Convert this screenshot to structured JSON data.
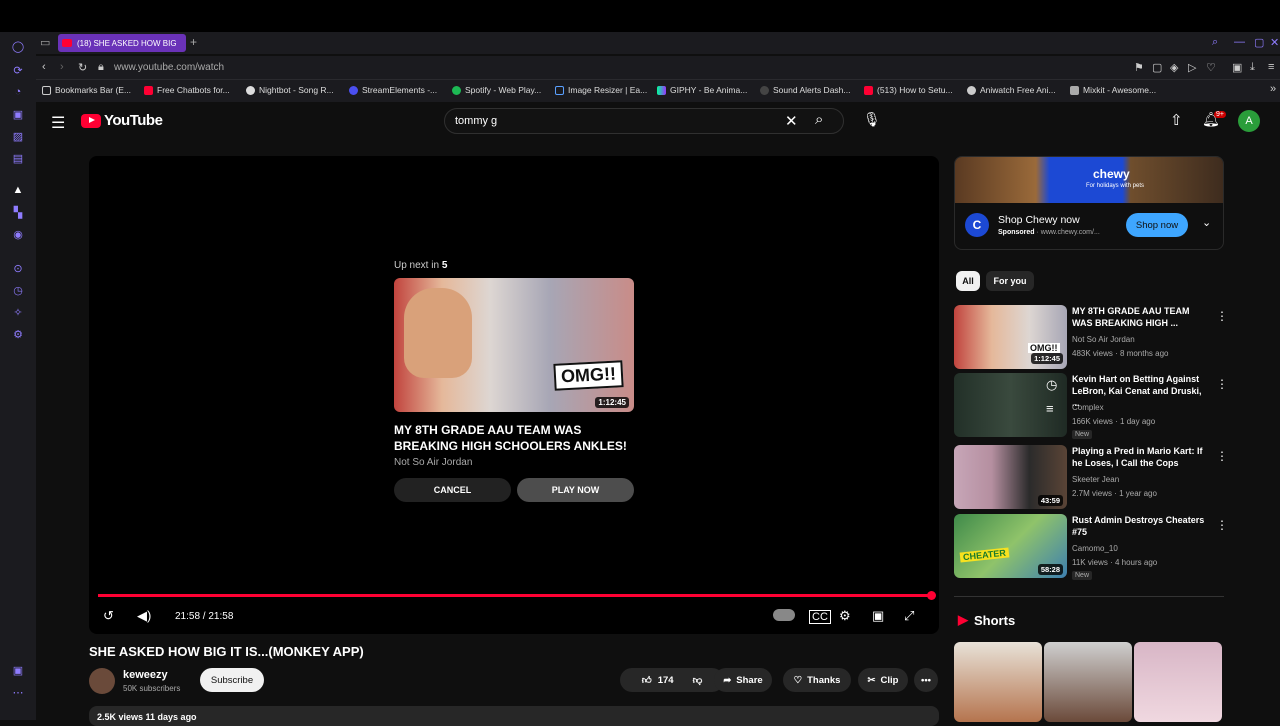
{
  "browser": {
    "tab_title": "(18) SHE ASKED HOW BIG",
    "new_tab": "+",
    "url": "www.youtube.com/watch",
    "bookmarks": [
      "Bookmarks Bar (E...",
      "Free Chatbots for...",
      "Nightbot - Song R...",
      "StreamElements -...",
      "Spotify - Web Play...",
      "Image Resizer | Ea...",
      "GIPHY - Be Anima...",
      "Sound Alerts Dash...",
      "(513) How to Setu...",
      "Aniwatch Free Ani...",
      "Mixkit - Awesome..."
    ]
  },
  "youtube": {
    "logo": "YouTube",
    "search_value": "tommy g",
    "notification_badge": "9+",
    "account_initial": "A"
  },
  "player": {
    "upnext_prefix": "Up next in",
    "upnext_count": "5",
    "upnext_title": "MY 8TH GRADE AAU TEAM WAS BREAKING HIGH SCHOOLERS ANKLES!",
    "upnext_channel": "Not So Air Jordan",
    "upnext_duration": "1:12:45",
    "upnext_thumb_text": "OMG!!",
    "cancel": "CANCEL",
    "play_now": "PLAY NOW",
    "time": "21:58 / 21:58",
    "progress": 1.0
  },
  "video": {
    "title": "SHE ASKED HOW BIG IT IS...(MONKEY APP)",
    "channel": "keweezy",
    "subscribers": "50K subscribers",
    "subscribe": "Subscribe",
    "likes": "174",
    "share": "Share",
    "thanks": "Thanks",
    "clip": "Clip",
    "views": "2.5K views  11 days ago"
  },
  "ad": {
    "brand": "chewy",
    "banner_tag": "For holidays with pets",
    "icon_letter": "C",
    "title": "Shop Chewy now",
    "sponsored": "Sponsored",
    "domain": " · www.chewy.com/...",
    "button": "Shop now"
  },
  "chips": [
    "All",
    "For you"
  ],
  "recommendations": [
    {
      "title": "MY 8TH GRADE AAU TEAM WAS BREAKING HIGH ...",
      "channel": "Not So Air Jordan",
      "meta": "483K views · 8 months ago",
      "duration": "1:12:45",
      "new": ""
    },
    {
      "title": "Kevin Hart on Betting Against LeBron, Kai Cenat and Druski, ...",
      "channel": "Complex",
      "meta": "166K views · 1 day ago",
      "duration": "",
      "new": "New"
    },
    {
      "title": "Playing a Pred in Mario Kart: If he Loses, I Call the Cops",
      "channel": "Skeeter Jean",
      "meta": "2.7M views · 1 year ago",
      "duration": "43:59",
      "new": ""
    },
    {
      "title": "Rust Admin Destroys Cheaters #75",
      "channel": "Camomo_10",
      "meta": "11K views · 4 hours ago",
      "duration": "58:28",
      "new": "New"
    }
  ],
  "rec_thumb_text_0": "OMG!!",
  "rec_thumb_text_3": "CHEATER",
  "shorts_label": "Shorts",
  "colors": {
    "accent": "#ff0033",
    "browser_accent": "#6a32b8",
    "ad_button": "#3ea6ff"
  }
}
